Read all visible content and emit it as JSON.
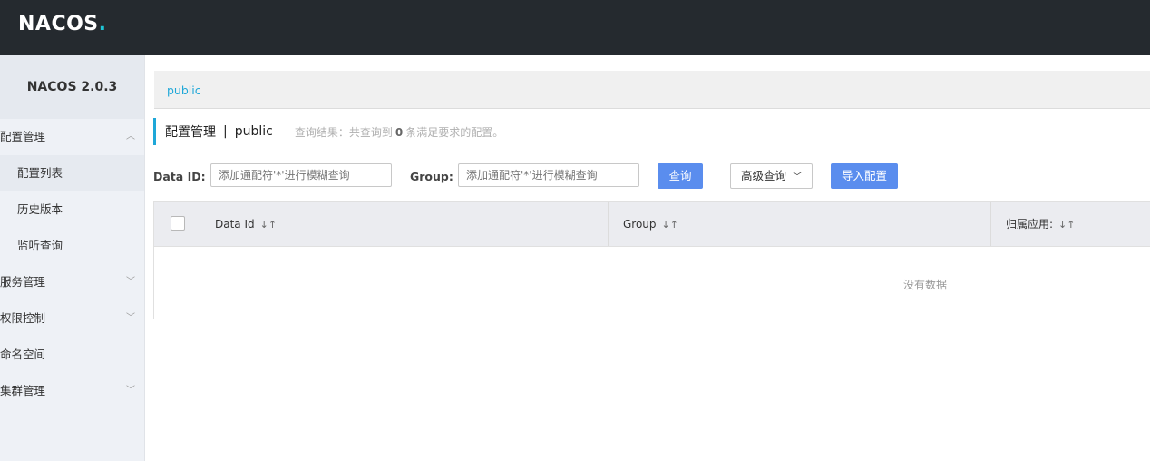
{
  "header": {
    "logo_text": "NACOS",
    "logo_dot": "."
  },
  "sidebar": {
    "title": "NACOS 2.0.3",
    "menus": [
      {
        "label": "配置管理",
        "expanded": true
      },
      {
        "label": "服务管理",
        "expanded": false
      },
      {
        "label": "权限控制",
        "expanded": false
      },
      {
        "label": "命名空间"
      },
      {
        "label": "集群管理",
        "expanded": false
      }
    ],
    "submenu": [
      {
        "label": "配置列表",
        "active": true
      },
      {
        "label": "历史版本"
      },
      {
        "label": "监听查询"
      }
    ]
  },
  "breadcrumb": {
    "namespace": "public"
  },
  "page": {
    "title": "配置管理",
    "separator": "|",
    "namespace": "public",
    "result_prefix": "查询结果：共查询到",
    "result_count": "0",
    "result_suffix": "条满足要求的配置。"
  },
  "search": {
    "data_id_label": "Data ID:",
    "data_id_placeholder": "添加通配符'*'进行模糊查询",
    "group_label": "Group:",
    "group_placeholder": "添加通配符'*'进行模糊查询",
    "query_button": "查询",
    "advanced_button": "高级查询",
    "import_button": "导入配置"
  },
  "table": {
    "columns": [
      "Data Id",
      "Group",
      "归属应用:"
    ],
    "empty_text": "没有数据"
  },
  "colors": {
    "topbar": "#252a2f",
    "accent": "#1ea7d8",
    "primary_button": "#5a8dee"
  }
}
